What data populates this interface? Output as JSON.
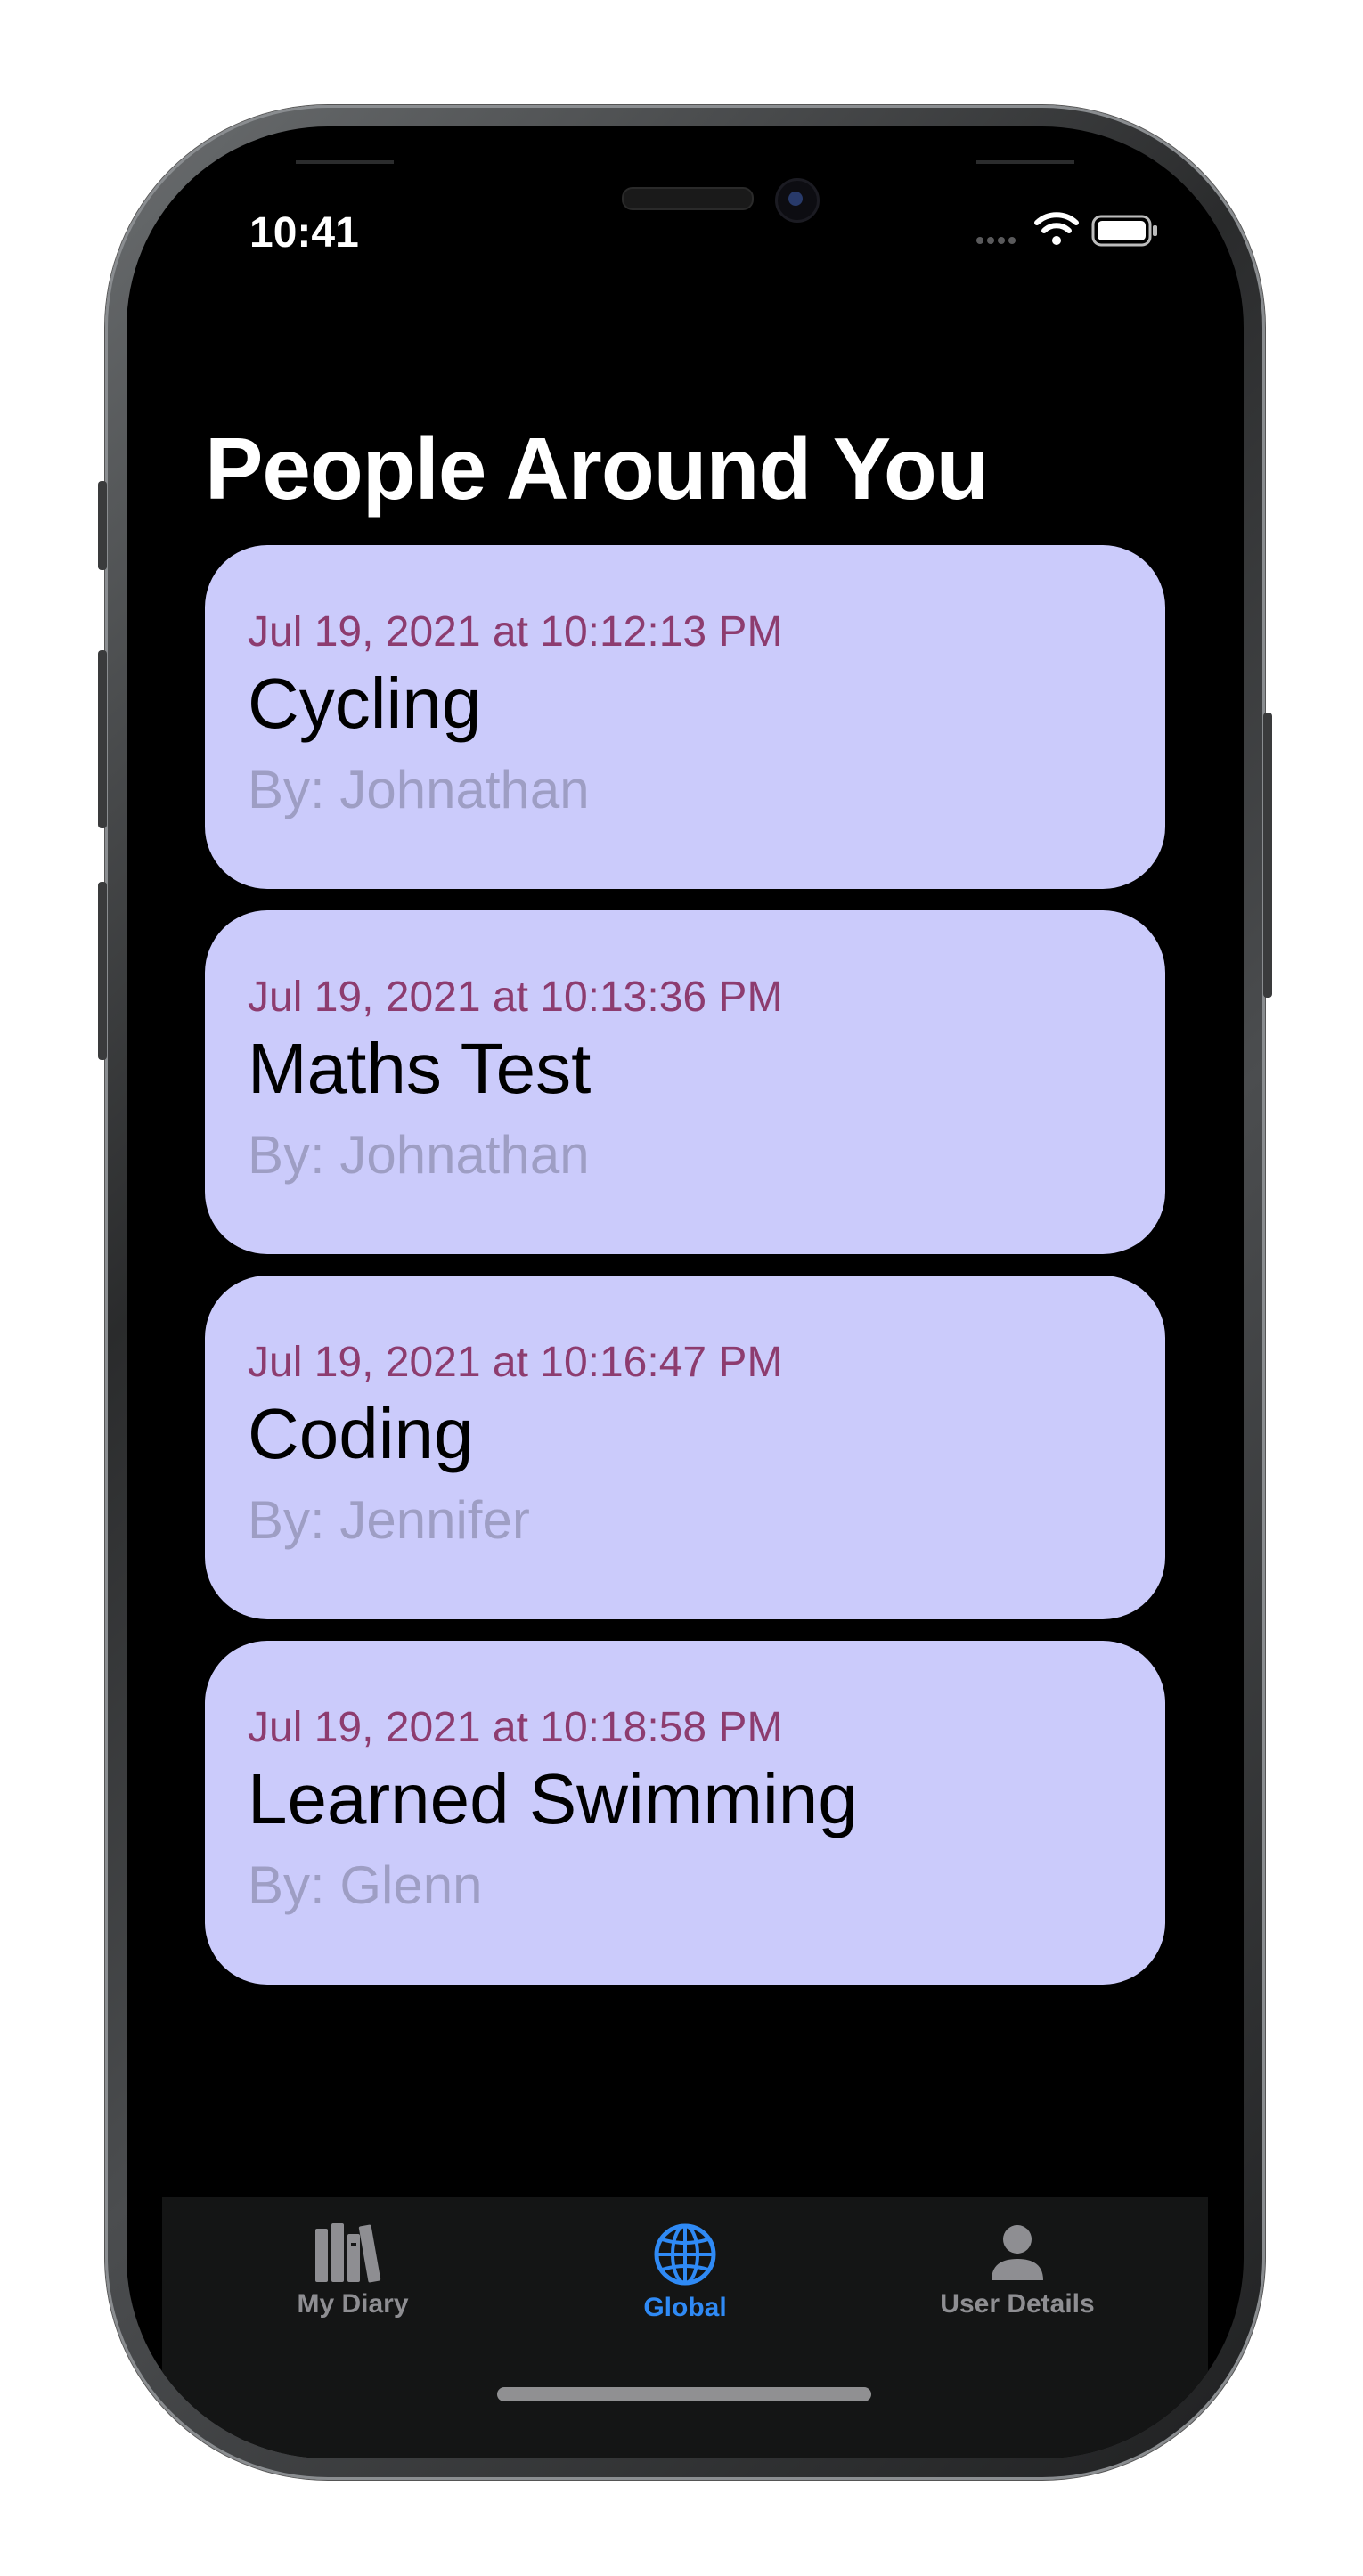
{
  "status_bar": {
    "time": "10:41"
  },
  "header": {
    "title": "People Around You"
  },
  "entries": [
    {
      "date": "Jul 19, 2021 at 10:12:13 PM",
      "title": "Cycling",
      "author": "By: Johnathan"
    },
    {
      "date": "Jul 19, 2021 at 10:13:36 PM",
      "title": "Maths Test",
      "author": "By: Johnathan"
    },
    {
      "date": "Jul 19, 2021 at 10:16:47 PM",
      "title": "Coding",
      "author": "By: Jennifer"
    },
    {
      "date": "Jul 19, 2021 at 10:18:58 PM",
      "title": "Learned Swimming",
      "author": "By: Glenn"
    }
  ],
  "tab_bar": {
    "tabs": [
      {
        "label": "My Diary",
        "icon": "books-icon",
        "active": false
      },
      {
        "label": "Global",
        "icon": "globe-icon",
        "active": true
      },
      {
        "label": "User Details",
        "icon": "person-icon",
        "active": false
      }
    ]
  },
  "colors": {
    "background": "#000000",
    "card_background": "#cbcbfb",
    "date_text": "#8d3c6f",
    "author_text": "#9e9ec4",
    "tab_active": "#2f8af5",
    "tab_inactive": "#8e8e92"
  }
}
